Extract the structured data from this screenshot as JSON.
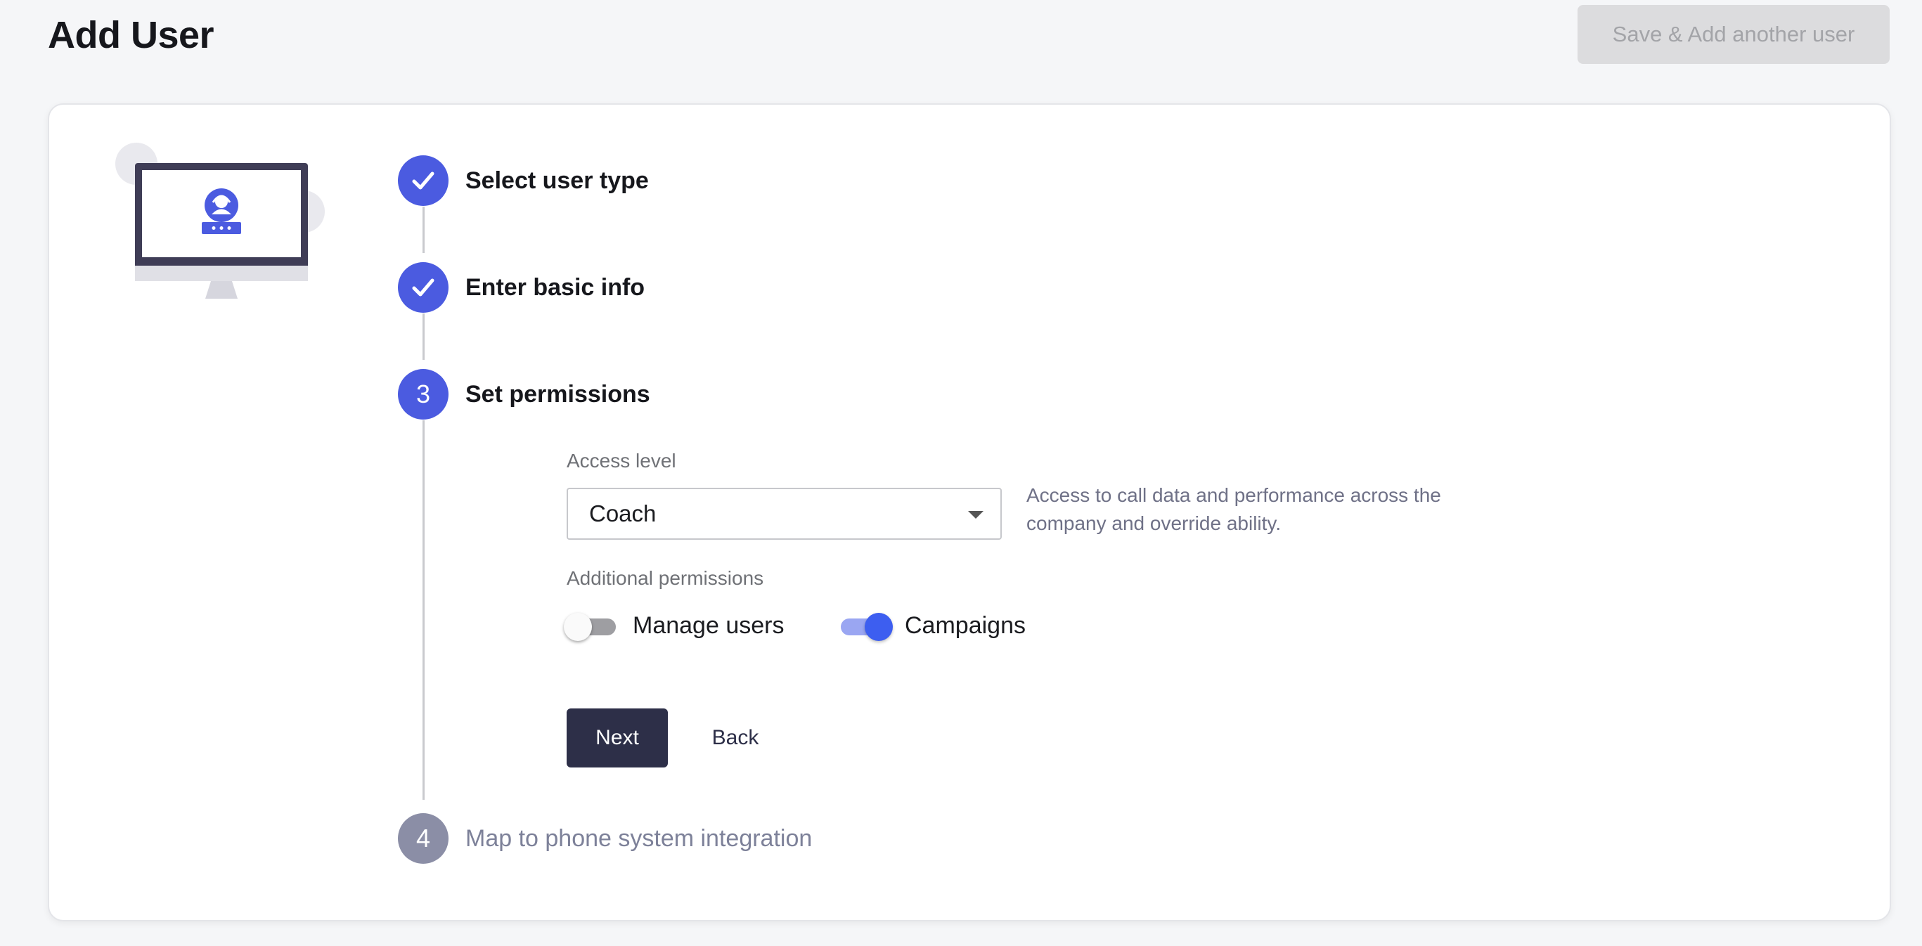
{
  "header": {
    "title": "Add User",
    "save_another_label": "Save & Add another user"
  },
  "steps": [
    {
      "number": "1",
      "label": "Select user type",
      "status": "done"
    },
    {
      "number": "2",
      "label": "Enter basic info",
      "status": "done"
    },
    {
      "number": "3",
      "label": "Set permissions",
      "status": "current"
    },
    {
      "number": "4",
      "label": "Map to phone system integration",
      "status": "upcoming"
    }
  ],
  "permissions": {
    "access_level_label": "Access level",
    "access_level_value": "Coach",
    "access_level_help": "Access to call data and performance across the company and override ability.",
    "additional_label": "Additional permissions",
    "toggles": [
      {
        "label": "Manage users",
        "on": false
      },
      {
        "label": "Campaigns",
        "on": true
      }
    ]
  },
  "actions": {
    "next_label": "Next",
    "back_label": "Back"
  },
  "icons": {
    "illustration": "computer-agent-icon",
    "done": "check-icon",
    "select": "caret-down-icon"
  },
  "colors": {
    "accent": "#4b5be0",
    "toggle_on": "#3d5ef0",
    "primary_button": "#2d2f48",
    "upcoming_step": "#8b8ea6",
    "disabled_button": "#dcdcde"
  }
}
